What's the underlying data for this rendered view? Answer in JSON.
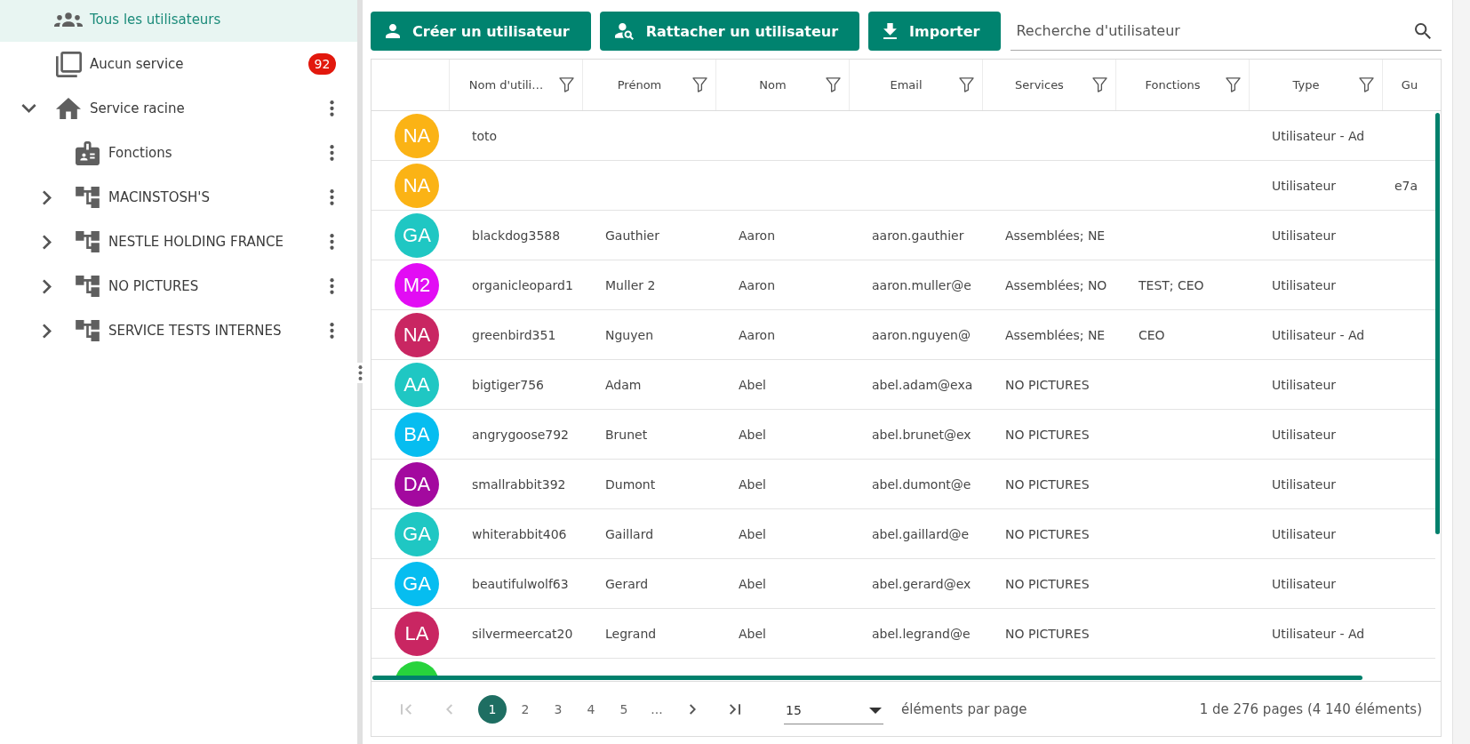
{
  "sidebar": {
    "items": [
      {
        "label": "Tous les utilisateurs",
        "kind": "all",
        "selected": true
      },
      {
        "label": "Aucun service",
        "kind": "unassigned",
        "selected": false,
        "badge": "92"
      },
      {
        "label": "Service racine",
        "kind": "root",
        "selected": false,
        "expanded": true,
        "children": [
          {
            "label": "Fonctions",
            "kind": "functions",
            "selected": false
          },
          {
            "label": "MACINSTOSH'S",
            "kind": "service",
            "selected": false,
            "expanded": false
          },
          {
            "label": "NESTLE HOLDING FRANCE",
            "kind": "service",
            "selected": false,
            "expanded": false
          },
          {
            "label": "NO PICTURES",
            "kind": "service",
            "selected": false,
            "expanded": false
          },
          {
            "label": "SERVICE TESTS INTERNES",
            "kind": "service",
            "selected": false,
            "expanded": false
          }
        ]
      }
    ]
  },
  "toolbar": {
    "buttons": [
      {
        "label": "Créer un utilisateur",
        "kind": "create"
      },
      {
        "label": "Rattacher un utilisateur",
        "kind": "attach"
      },
      {
        "label": "Importer",
        "kind": "import"
      }
    ],
    "search": {
      "placeholder": "Recherche d'utilisateur"
    }
  },
  "table": {
    "columns": [
      {
        "label": "Nom d'utili…",
        "filterable": true
      },
      {
        "label": "Prénom",
        "filterable": true
      },
      {
        "label": "Nom",
        "filterable": true
      },
      {
        "label": "Email",
        "filterable": true
      },
      {
        "label": "Services",
        "filterable": true
      },
      {
        "label": "Fonctions",
        "filterable": true
      },
      {
        "label": "Type",
        "filterable": true
      },
      {
        "label": "Gu",
        "filterable": false
      }
    ],
    "rows": [
      {
        "initials": "NA",
        "color": "#fbb315",
        "username": "toto",
        "type": "Utilisateur - Ad"
      },
      {
        "initials": "NA",
        "color": "#fbb315",
        "type": "Utilisateur",
        "column_8": "e7a"
      },
      {
        "initials": "GA",
        "color": "#1fc7c3",
        "username": "blackdog3588",
        "first_name": "Gauthier",
        "last_name": "Aaron",
        "email": "aaron.gauthier",
        "services": "Assemblées; NE",
        "type": "Utilisateur"
      },
      {
        "initials": "M2",
        "color": "#e20cf4",
        "username": "organicleopard1",
        "first_name": "Muller 2",
        "last_name": "Aaron",
        "email": "aaron.muller@e",
        "services": "Assemblées; NO",
        "functions": "TEST; CEO",
        "type": "Utilisateur"
      },
      {
        "initials": "NA",
        "color": "#c92662",
        "username": "greenbird351",
        "first_name": "Nguyen",
        "last_name": "Aaron",
        "email": "aaron.nguyen@",
        "services": "Assemblées; NE",
        "functions": "CEO",
        "type": "Utilisateur - Ad"
      },
      {
        "initials": "AA",
        "color": "#1fc7c3",
        "username": "bigtiger756",
        "first_name": "Adam",
        "last_name": "Abel",
        "email": "abel.adam@exa",
        "services": "NO PICTURES",
        "type": "Utilisateur"
      },
      {
        "initials": "BA",
        "color": "#06bdf0",
        "username": "angrygoose792",
        "first_name": "Brunet",
        "last_name": "Abel",
        "email": "abel.brunet@ex",
        "services": "NO PICTURES",
        "type": "Utilisateur"
      },
      {
        "initials": "DA",
        "color": "#a3099f",
        "username": "smallrabbit392",
        "first_name": "Dumont",
        "last_name": "Abel",
        "email": "abel.dumont@e",
        "services": "NO PICTURES",
        "type": "Utilisateur"
      },
      {
        "initials": "GA",
        "color": "#1fc7c3",
        "username": "whiterabbit406",
        "first_name": "Gaillard",
        "last_name": "Abel",
        "email": "abel.gaillard@e",
        "services": "NO PICTURES",
        "type": "Utilisateur"
      },
      {
        "initials": "GA",
        "color": "#06bdf0",
        "username": "beautifulwolf63",
        "first_name": "Gerard",
        "last_name": "Abel",
        "email": "abel.gerard@ex",
        "services": "NO PICTURES",
        "type": "Utilisateur"
      },
      {
        "initials": "LA",
        "color": "#c92662",
        "username": "silvermeercat20",
        "first_name": "Legrand",
        "last_name": "Abel",
        "email": "abel.legrand@e",
        "services": "NO PICTURES",
        "type": "Utilisateur - Ad"
      },
      {
        "color": "#27d33c"
      }
    ]
  },
  "pagination": {
    "first": {
      "disabled": true
    },
    "previous": {
      "disabled": true
    },
    "pages": [
      {
        "label": "1",
        "selected": true
      },
      {
        "label": "2",
        "selected": false
      },
      {
        "label": "3",
        "selected": false
      },
      {
        "label": "4",
        "selected": false
      },
      {
        "label": "5",
        "selected": false
      },
      {
        "label": "...",
        "selected": false
      }
    ],
    "next": {
      "disabled": false
    },
    "last": {
      "disabled": false
    },
    "page_size": "15",
    "page_size_label": "éléments par page",
    "summary": "1 de 276 pages (4 140 éléments)"
  }
}
